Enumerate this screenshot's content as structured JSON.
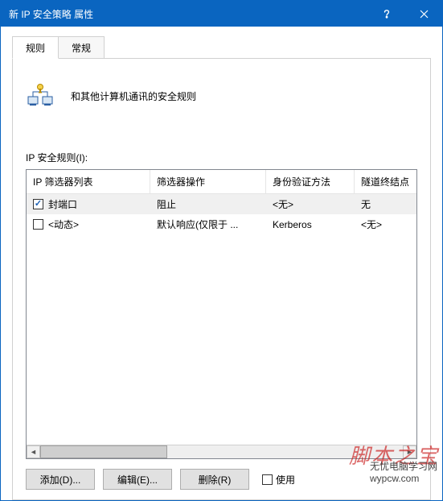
{
  "window": {
    "title": "新 IP 安全策略 属性"
  },
  "tabs": [
    {
      "label": "规则",
      "active": true
    },
    {
      "label": "常规",
      "active": false
    }
  ],
  "description": "和其他计算机通讯的安全规则",
  "section_label": "IP 安全规则(I):",
  "columns": [
    "IP 筛选器列表",
    "筛选器操作",
    "身份验证方法",
    "隧道终结点"
  ],
  "rows": [
    {
      "checked": true,
      "filter": "封端口",
      "action": "阻止",
      "auth": "<无>",
      "tunnel": "无"
    },
    {
      "checked": false,
      "filter": "<动态>",
      "action": "默认响应(仅限于 ...",
      "auth": "Kerberos",
      "tunnel": "<无>"
    }
  ],
  "buttons": {
    "add": "添加(D)...",
    "edit": "编辑(E)...",
    "remove": "删除(R)"
  },
  "use_wizard": {
    "checked": false,
    "label": "使用"
  },
  "watermark_main": "脚本之宝",
  "watermark_sub": "无忧电脑学习网",
  "watermark_url": "wypcw.com"
}
